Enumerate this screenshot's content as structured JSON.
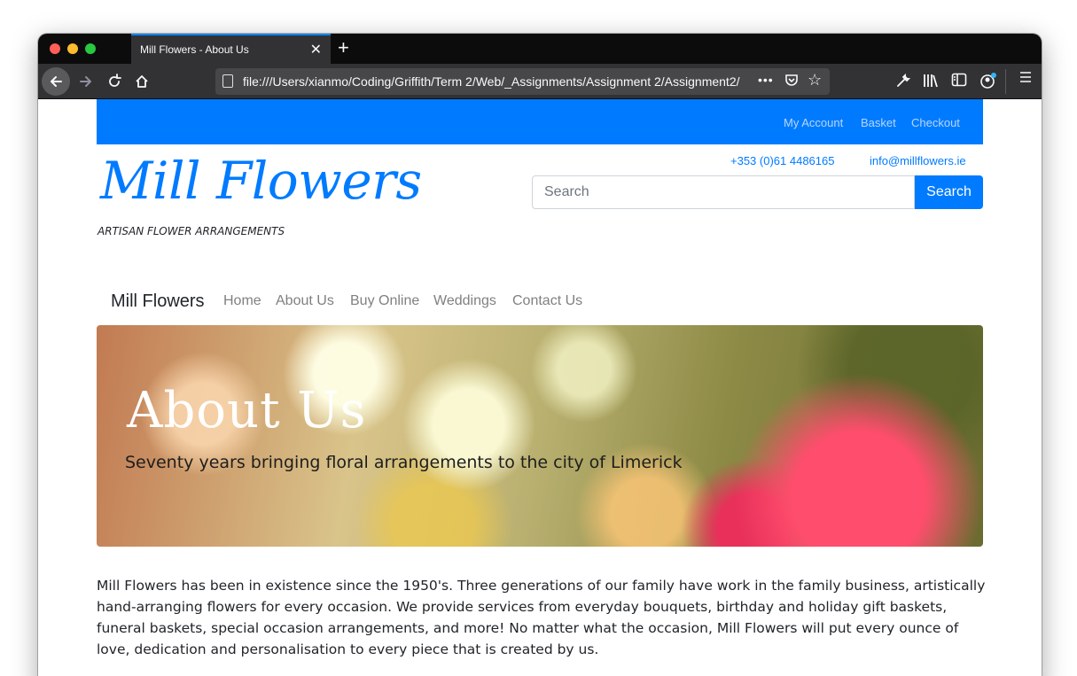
{
  "browser": {
    "tab_title": "Mill Flowers - About Us",
    "tab_close": "✕",
    "new_tab": "+",
    "url": "file:///Users/xianmo/Coding/Griffith/Term 2/Web/_Assignments/Assignment 2/Assignment2/",
    "url_more": "•••",
    "icons": [
      "back-arrow-icon",
      "forward-arrow-icon",
      "reload-icon",
      "home-icon",
      "page-icon",
      "more-icon",
      "pocket-icon",
      "bookmark-star-icon",
      "wrench-icon",
      "library-icon",
      "sidebar-icon",
      "account-icon",
      "hamburger-menu-icon"
    ]
  },
  "topbar": {
    "my_account": "My Account",
    "basket": "Basket",
    "checkout": "Checkout",
    "color": "#007bff"
  },
  "header": {
    "brand": "Mill Flowers",
    "tagline": "ARTISAN FLOWER ARRANGEMENTS",
    "phone": "+353 (0)61 4486165",
    "email": "info@millflowers.ie",
    "search_placeholder": "Search",
    "search_button": "Search"
  },
  "nav": {
    "brand": "Mill Flowers",
    "links": [
      "Home",
      "About Us",
      "Buy Online",
      "Weddings",
      "Contact Us"
    ]
  },
  "hero": {
    "title": "About Us",
    "subtitle": "Seventy years bringing floral arrangements to the city of Limerick"
  },
  "main": {
    "paragraph": "Mill Flowers has been in existence since the 1950's. Three generations of our family have work in the family business, artistically hand-arranging flowers for every occasion. We provide services from everyday bouquets, birthday and holiday gift baskets, funeral baskets, special occasion arrangements, and more! No matter what the occasion, Mill Flowers will put every ounce of love, dedication and personalisation to every piece that is created by us."
  }
}
